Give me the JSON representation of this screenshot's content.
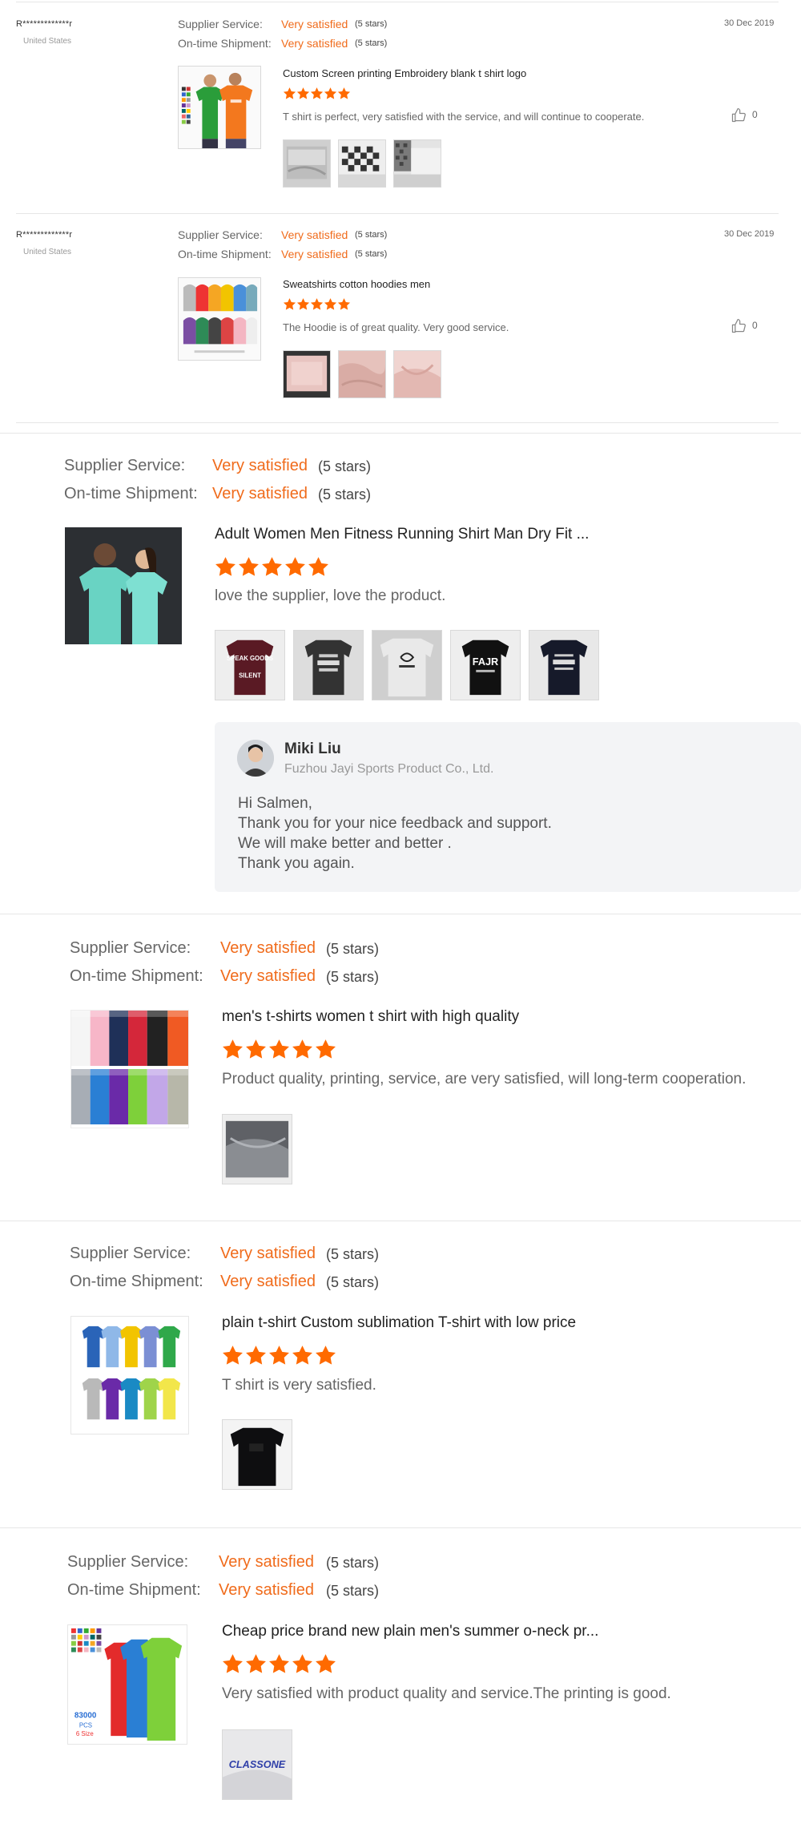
{
  "reviews_compact": [
    {
      "reviewer": "R*************r",
      "country": "United States",
      "date": "30 Dec 2019",
      "supplier_label": "Supplier Service:",
      "supplier_value": "Very satisfied",
      "supplier_stars": "(5 stars)",
      "shipment_label": "On-time Shipment:",
      "shipment_value": "Very satisfied",
      "shipment_stars": "(5 stars)",
      "product_title": "Custom Screen printing Embroidery blank t shirt logo",
      "rating": 5,
      "text": "T shirt is perfect, very satisfied with the service, and will continue to cooperate.",
      "likes": "0"
    },
    {
      "reviewer": "R*************r",
      "country": "United States",
      "date": "30 Dec 2019",
      "supplier_label": "Supplier Service:",
      "supplier_value": "Very satisfied",
      "supplier_stars": "(5 stars)",
      "shipment_label": "On-time Shipment:",
      "shipment_value": "Very satisfied",
      "shipment_stars": "(5 stars)",
      "product_title": "Sweatshirts cotton hoodies men",
      "rating": 5,
      "text": "The Hoodie is of great quality.  Very good service.",
      "likes": "0"
    }
  ],
  "reviews_large": [
    {
      "supplier_label": "Supplier Service:",
      "supplier_value": "Very satisfied",
      "supplier_stars": "(5 stars)",
      "shipment_label": "On-time Shipment:",
      "shipment_value": "Very satisfied",
      "shipment_stars": "(5 stars)",
      "product_title": "Adult Women Men Fitness Running Shirt Man Dry Fit ...",
      "rating": 5,
      "text": "love the supplier, love the product.",
      "reply": {
        "name": "Miki Liu",
        "company": "Fuzhou Jayi Sports Product Co., Ltd.",
        "lines": [
          "Hi Salmen,",
          "Thank you for your nice feedback and support.",
          "We will make better and better .",
          "Thank you again."
        ]
      }
    },
    {
      "supplier_label": "Supplier Service:",
      "supplier_value": "Very satisfied",
      "supplier_stars": "(5 stars)",
      "shipment_label": "On-time Shipment:",
      "shipment_value": "Very satisfied",
      "shipment_stars": "(5 stars)",
      "product_title": "men's t-shirts women t shirt with high quality",
      "rating": 5,
      "text": "Product quality, printing, service, are very satisfied, will long-term cooperation."
    },
    {
      "supplier_label": "Supplier Service:",
      "supplier_value": "Very satisfied",
      "supplier_stars": "(5 stars)",
      "shipment_label": "On-time Shipment:",
      "shipment_value": "Very satisfied",
      "shipment_stars": "(5 stars)",
      "product_title": "plain t-shirt Custom sublimation T-shirt with low price",
      "rating": 5,
      "text": "T shirt is very satisfied."
    },
    {
      "supplier_label": "Supplier Service:",
      "supplier_value": "Very satisfied",
      "supplier_stars": "(5 stars)",
      "shipment_label": "On-time Shipment:",
      "shipment_value": "Very satisfied",
      "shipment_stars": "(5 stars)",
      "product_title": "Cheap price brand new plain men's summer o-neck pr...",
      "rating": 5,
      "text": "Very satisfied with product quality and service.The printing is good.",
      "product_image_text": [
        "83000",
        "PCS",
        "6 Size"
      ],
      "photo_text": "CLASSONE"
    }
  ],
  "photo_texts": {
    "review3_photo1": [
      "SPEAK GOODS",
      "SILENT"
    ],
    "review3_photo4": [
      "FAJR"
    ]
  },
  "colors": {
    "accent": "#f06b1b",
    "star": "#ff6a00",
    "divider": "#e6e6e6",
    "reply_bg": "#f3f4f6"
  },
  "icons": [
    "thumbs-up-icon",
    "star-icon",
    "avatar"
  ]
}
